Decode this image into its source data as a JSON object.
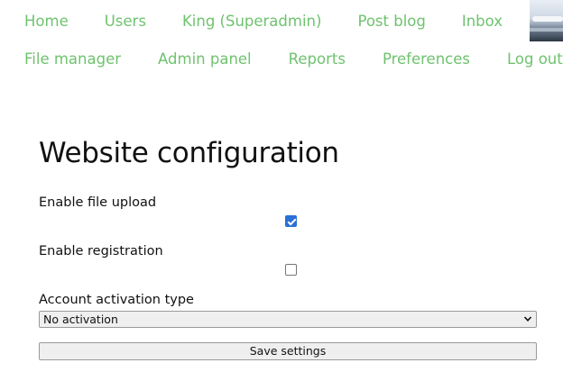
{
  "nav": {
    "row1": [
      "Home",
      "Users",
      "King (Superadmin)",
      "Post blog",
      "Inbox"
    ],
    "row2": [
      "File manager",
      "Admin panel",
      "Reports",
      "Preferences",
      "Log out"
    ],
    "link_color": "#6fc26f"
  },
  "avatar": {
    "icon": "user-avatar-image"
  },
  "page": {
    "title": "Website configuration"
  },
  "settings": {
    "file_upload": {
      "label": "Enable file upload",
      "checked": true
    },
    "registration": {
      "label": "Enable registration",
      "checked": false
    },
    "activation": {
      "label": "Account activation type",
      "selected": "No activation"
    },
    "save_label": "Save settings"
  },
  "colors": {
    "checkbox_accent": "#2a6fd6"
  }
}
